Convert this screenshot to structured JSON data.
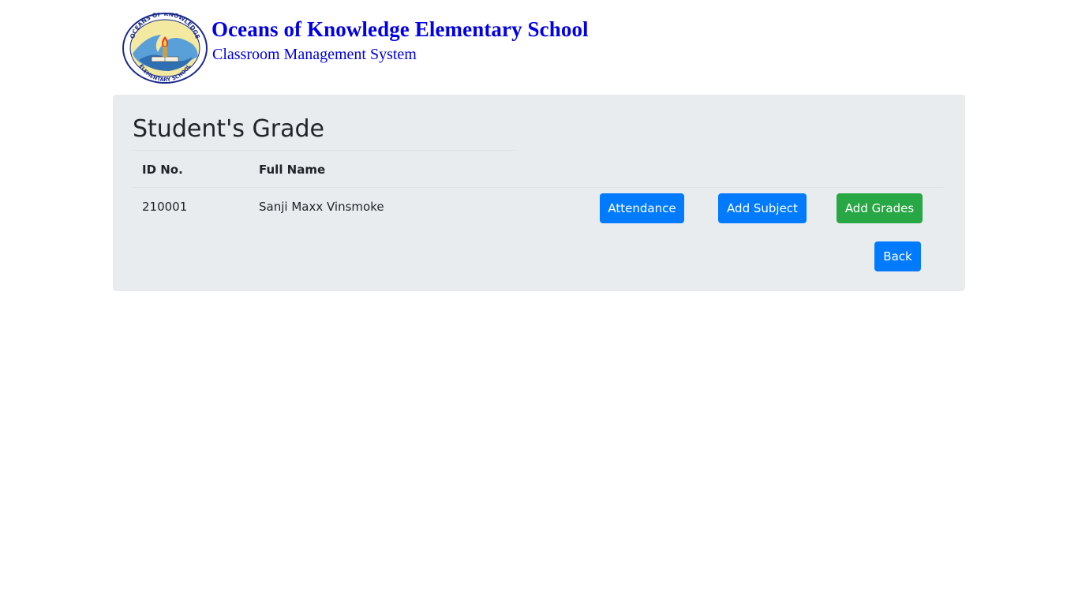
{
  "header": {
    "school_name": "Oceans of Knowledge Elementary School",
    "system_name": "Classroom Management System",
    "logo": {
      "top_text": "OCEANS OF KNOWLEDGE",
      "bottom_text": "ELEMENTARY SCHOOL"
    }
  },
  "panel": {
    "title": "Student's Grade",
    "table": {
      "columns": [
        "ID No.",
        "Full Name"
      ],
      "rows": [
        {
          "id_no": "210001",
          "full_name": "Sanji Maxx Vinsmoke",
          "actions": {
            "attendance": "Attendance",
            "add_subject": "Add Subject",
            "add_grades": "Add Grades"
          }
        }
      ]
    },
    "back_label": "Back"
  },
  "colors": {
    "brand_blue": "#0000e6",
    "primary": "#007bff",
    "success": "#28a745",
    "panel_bg": "#e9ecef"
  }
}
